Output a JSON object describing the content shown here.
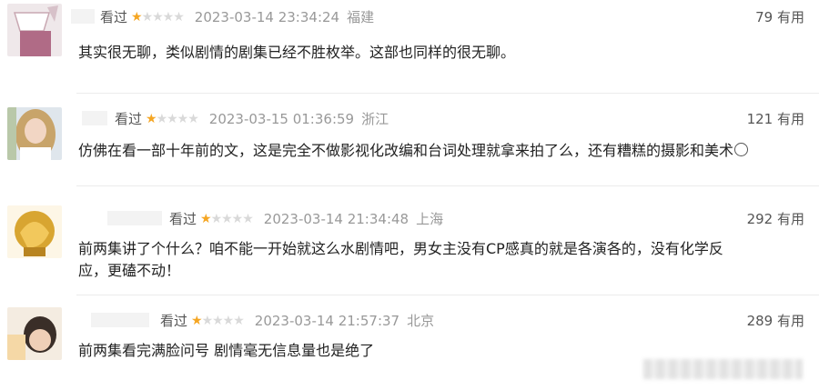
{
  "reviews": [
    {
      "status": "看过",
      "rating": 1,
      "time": "2023-03-14 23:34:24",
      "region": "福建",
      "useful_count": "79",
      "useful_label": "有用",
      "content": "其实很无聊，类似剧情的剧集已经不胜枚举。这部也同样的很无聊。"
    },
    {
      "status": "看过",
      "rating": 1,
      "time": "2023-03-15 01:36:59",
      "region": "浙江",
      "useful_count": "121",
      "useful_label": "有用",
      "content": "仿佛在看一部十年前的文，这是完全不做影视化改编和台词处理就拿来拍了么，还有糟糕的摄影和美术"
    },
    {
      "status": "看过",
      "rating": 1,
      "time": "2023-03-14 21:34:48",
      "region": "上海",
      "useful_count": "292",
      "useful_label": "有用",
      "content": "前两集讲了个什么？咱不能一开始就这么水剧情吧，男女主没有CP感真的就是各演各的，没有化学反应，更磕不动！"
    },
    {
      "status": "看过",
      "rating": 1,
      "time": "2023-03-14 21:57:37",
      "region": "北京",
      "useful_count": "289",
      "useful_label": "有用",
      "content": "前两集看完满脸问号 剧情毫无信息量也是绝了"
    }
  ],
  "colors": {
    "star_on": "#f5a623",
    "star_off": "#d9d9d9"
  },
  "icons": [
    "star-icon",
    "smiley-icon"
  ]
}
